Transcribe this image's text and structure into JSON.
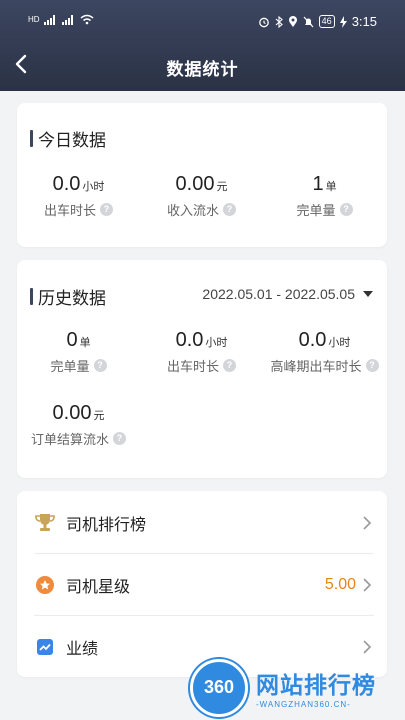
{
  "status_bar": {
    "network": "HD",
    "time": "3:15",
    "battery": "46"
  },
  "nav": {
    "title": "数据统计"
  },
  "today": {
    "title": "今日数据",
    "stats": [
      {
        "value": "0.0",
        "unit": "小时",
        "label": "出车时长"
      },
      {
        "value": "0.00",
        "unit": "元",
        "label": "收入流水"
      },
      {
        "value": "1",
        "unit": "单",
        "label": "完单量"
      }
    ]
  },
  "history": {
    "title": "历史数据",
    "date_range": "2022.05.01 - 2022.05.05",
    "stats": [
      {
        "value": "0",
        "unit": "单",
        "label": "完单量"
      },
      {
        "value": "0.0",
        "unit": "小时",
        "label": "出车时长"
      },
      {
        "value": "0.0",
        "unit": "小时",
        "label": "高峰期出车时长"
      },
      {
        "value": "0.00",
        "unit": "元",
        "label": "订单结算流水"
      }
    ]
  },
  "menu": [
    {
      "label": "司机排行榜",
      "value": ""
    },
    {
      "label": "司机星级",
      "value": "5.00"
    },
    {
      "label": "业绩",
      "value": ""
    }
  ],
  "watermark": {
    "badge": "360",
    "title": "网站排行榜",
    "subtitle": "-WANGZHAN360.CN-"
  },
  "colors": {
    "header": "#3c4660",
    "accent": "#e8841a",
    "watermark": "#2f8ae0"
  }
}
